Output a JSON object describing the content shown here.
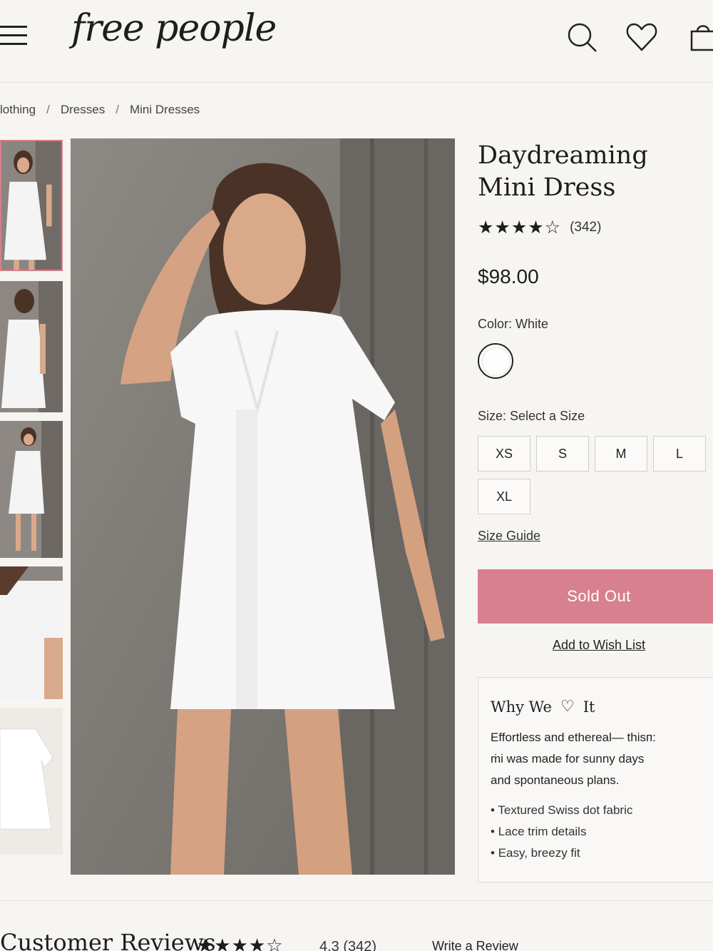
{
  "header": {
    "logo": "free people",
    "icons": [
      "menu-icon",
      "search-icon",
      "heart-icon",
      "bag-icon"
    ]
  },
  "breadcrumb": [
    "lothing",
    "Dresses",
    "Mini Dresses"
  ],
  "product": {
    "title": "Daydreaming Mini Dress",
    "stars": "★★★★☆",
    "rating_value": 4,
    "review_count": "(342)",
    "price": "$98.00",
    "color_label": "Color: White",
    "color_swatch": "#fefefe",
    "size_label": "Size: Select a Size",
    "sizes": [
      "XS",
      "S",
      "M",
      "L",
      "XL"
    ],
    "size_guide": "Size Guide",
    "sold_out_label": "Sold Out",
    "wishlist_label": "Add to Wish List"
  },
  "why": {
    "title_before": "Why We",
    "title_after": "It",
    "text_line1": "Effortless and ethereal— thisп:",
    "text_line2": "ṁi was made for sunny days",
    "text_line3": "and spontaneous plans.",
    "bullets": [
      "Textured Swiss dot fabric",
      "Lace trim details",
      "Easy, breezy fit"
    ]
  },
  "reviews": {
    "title": "Customer Reviews",
    "stars": "★★★★☆",
    "score": "4.3 (342)",
    "write_review": "Write a Review"
  },
  "colors": {
    "accent": "#d8808e",
    "background": "#f7f5f2",
    "thumbnail_active_border": "#d87d8b"
  }
}
